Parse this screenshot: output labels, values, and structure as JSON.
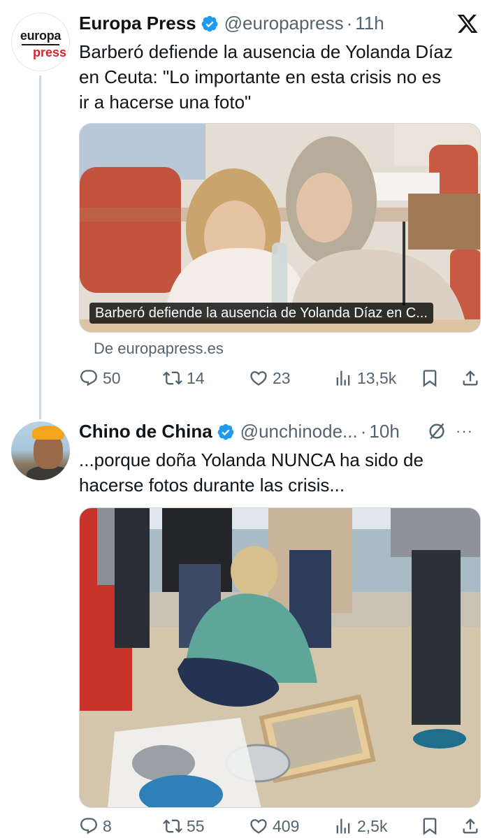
{
  "tweets": [
    {
      "avatar": {
        "logo_top": "europa",
        "logo_bottom": "press"
      },
      "name": "Europa Press",
      "handle": "@europapress",
      "separator": "·",
      "time": "11h",
      "text_lines": [
        "Barberó defiende la ausencia de Yolanda Díaz",
        "en Ceuta: \"Lo importante en esta crisis no es",
        "ir a hacerse una foto\""
      ],
      "card_caption": "Barberó defiende la ausencia de Yolanda Díaz en C...",
      "source": "De europapress.es",
      "stats": {
        "replies": "50",
        "reposts": "14",
        "likes": "23",
        "views": "13,5k"
      }
    },
    {
      "name": "Chino de China",
      "handle": "@unchinode...",
      "separator": "·",
      "time": "10h",
      "more": "···",
      "text_lines": [
        "...porque doña Yolanda NUNCA ha sido de",
        "hacerse fotos durante las crisis..."
      ],
      "stats": {
        "replies": "8",
        "reposts": "55",
        "likes": "409",
        "views": "2,5k"
      }
    }
  ],
  "colors": {
    "verified": "#1d9bf0",
    "muted": "#536471",
    "text": "#0f1419",
    "brand_red": "#d7262d"
  },
  "icons": [
    "x-logo-icon",
    "verified-badge-icon",
    "reply-icon",
    "repost-icon",
    "like-icon",
    "views-icon",
    "bookmark-icon",
    "share-icon",
    "grok-icon",
    "more-icon"
  ]
}
